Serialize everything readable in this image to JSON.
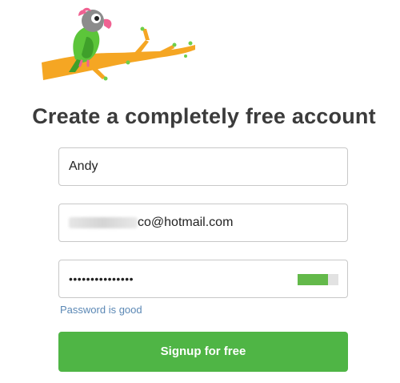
{
  "header": {
    "logo_icon": "parrot-on-branch-icon",
    "title": "Create a completely free account"
  },
  "form": {
    "name_value": "Andy",
    "email_value": "co@hotmail.com",
    "password_value": "•••••••••••••••",
    "password_strength": 0.75,
    "password_hint": "Password is good",
    "signup_label": "Signup for free"
  },
  "colors": {
    "accent": "#4fb545",
    "strength": "#63b94a",
    "hint": "#5b88b5",
    "title": "#3b3b3b"
  }
}
